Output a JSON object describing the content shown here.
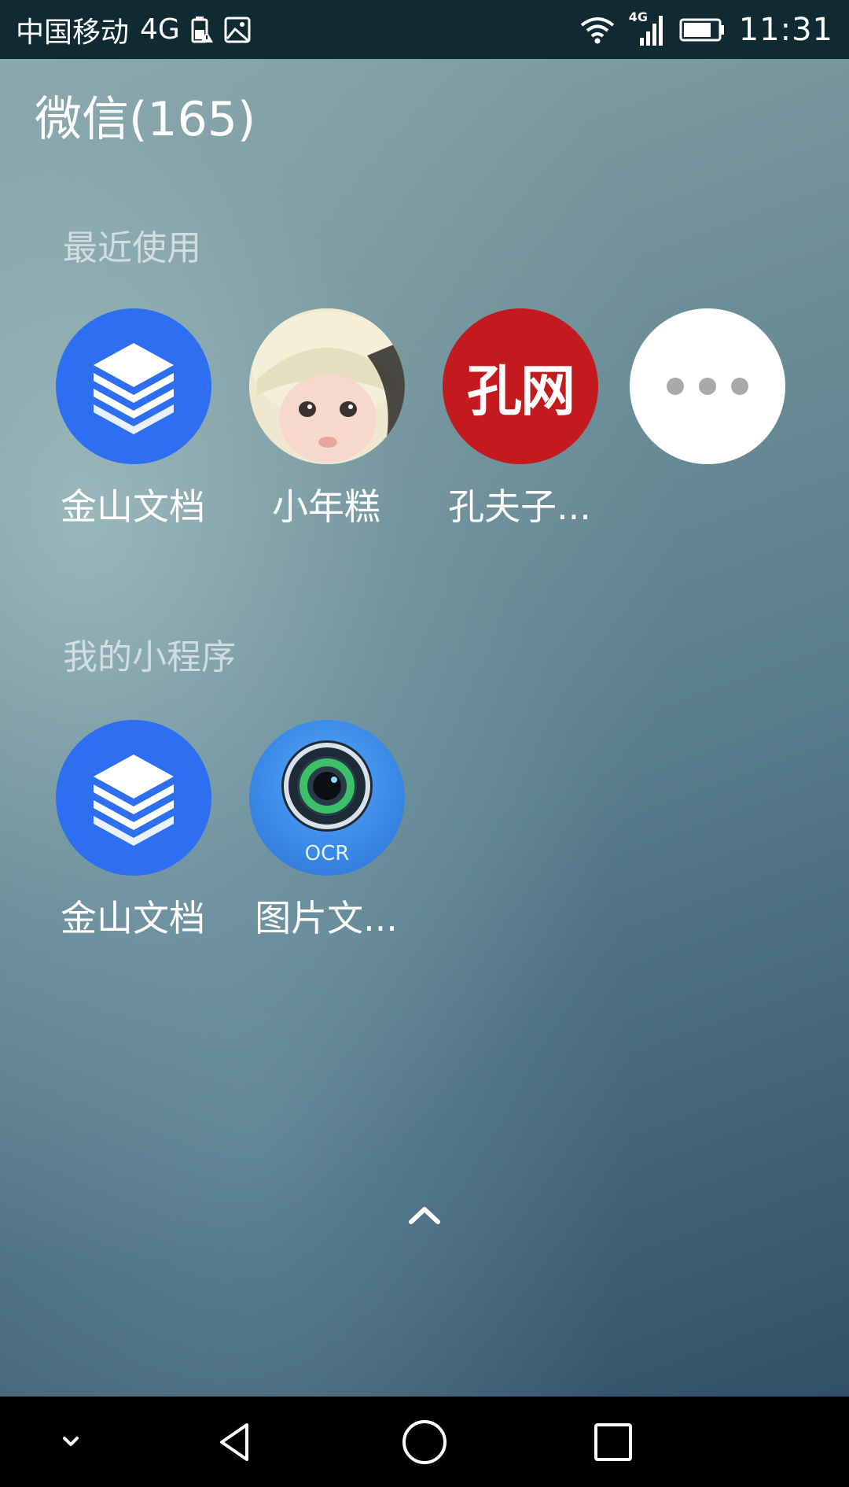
{
  "status_bar": {
    "carrier": "中国移动",
    "network": "4G",
    "signal_label": "4G",
    "time": "11:31",
    "icons": [
      "battery-warning-icon",
      "image-notification-icon",
      "wifi-icon",
      "cell-signal-icon",
      "battery-icon"
    ]
  },
  "header": {
    "title": "微信(165)"
  },
  "recent": {
    "label": "最近使用",
    "items": [
      {
        "label": "金山文档",
        "icon": "kingsoft-docs-icon"
      },
      {
        "label": "小年糕",
        "icon": "baby-avatar-icon"
      },
      {
        "label": "孔夫子...",
        "icon": "kongwang-logo-icon",
        "logo_text": "孔网"
      },
      {
        "label": "",
        "icon": "more-icon"
      }
    ]
  },
  "mine": {
    "label": "我的小程序",
    "items": [
      {
        "label": "金山文档",
        "icon": "kingsoft-docs-icon"
      },
      {
        "label": "图片文...",
        "icon": "ocr-camera-icon",
        "badge_text": "OCR"
      }
    ]
  },
  "nav": {
    "buttons": [
      "hide-nav-icon",
      "back-icon",
      "home-icon",
      "recents-icon"
    ]
  },
  "colors": {
    "status_bar_bg": "#0f2a33",
    "kingsoft_blue": "#2d6ff0",
    "kongwang_red": "#c21a1f",
    "nav_bg": "#000000"
  }
}
